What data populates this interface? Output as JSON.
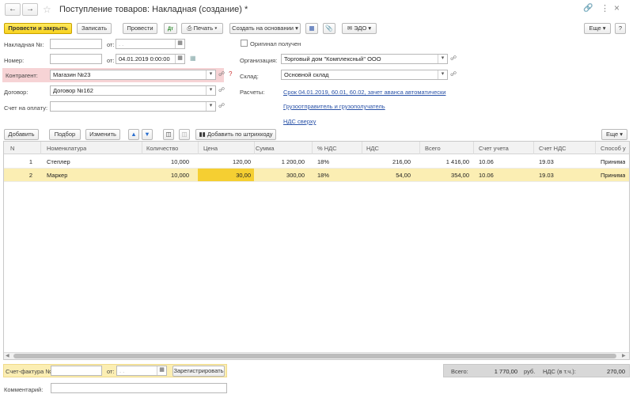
{
  "window": {
    "title": "Поступление товаров: Накладная (создание) *"
  },
  "toolbar": {
    "post_close": "Провести и закрыть",
    "save": "Записать",
    "post": "Провести",
    "print": "Печать",
    "create_based": "Создать на основании",
    "edo": "ЭДО",
    "more": "Еще"
  },
  "form": {
    "invoice_no_label": "Накладная №:",
    "invoice_from_label": "от:",
    "invoice_date_placeholder": ". .",
    "number_label": "Номер:",
    "number_from_label": "от:",
    "number_date": "04.01.2019  0:00:00",
    "contractor_label": "Контрагент:",
    "contractor_value": "Магазин №23",
    "contract_label": "Договор:",
    "contract_value": "Договор №162",
    "pay_account_label": "Счет на оплату:",
    "original_received_label": "Оригинал получен",
    "organization_label": "Организация:",
    "organization_value": "Торговый дом \"Комплексный\" ООО",
    "warehouse_label": "Склад:",
    "warehouse_value": "Основной склад",
    "settlements_label": "Расчеты:",
    "settlements_link": "Срок 04.01.2019, 60.01, 60.02, зачет аванса автоматически",
    "consignor_link": "Грузоотправитель и грузополучатель",
    "vat_link": "НДС сверху"
  },
  "table_toolbar": {
    "add": "Добавить",
    "pick": "Подбор",
    "edit": "Изменить",
    "barcode": "Добавить по штрихкоду",
    "more": "Еще"
  },
  "table": {
    "headers": [
      "N",
      "Номенклатура",
      "Количество",
      "Цена",
      "Сумма",
      "% НДС",
      "НДС",
      "Всего",
      "Счет учета",
      "Счет НДС",
      "Способ у"
    ],
    "rows": [
      [
        "1",
        "Степлер",
        "10,000",
        "120,00",
        "1 200,00",
        "18%",
        "216,00",
        "1 416,00",
        "10.06",
        "19.03",
        "Принима"
      ],
      [
        "2",
        "Маркер",
        "10,000",
        "30,00",
        "300,00",
        "18%",
        "54,00",
        "354,00",
        "10.06",
        "19.03",
        "Принима"
      ]
    ]
  },
  "footer": {
    "invoice_label": "Счет-фактура №:",
    "invoice_from": "от:",
    "invoice_date_placeholder": ". .",
    "register": "Зарегистрировать",
    "comment_label": "Комментарий:",
    "total_label": "Всего:",
    "total_value": "1 770,00",
    "currency": "руб.",
    "vat_label": "НДС (в т.ч.):",
    "vat_value": "270,00"
  },
  "colors": {
    "accent_yellow": "#f8d21f",
    "selected_row": "#fbeeb3",
    "highlight_cell": "#f5cf32",
    "link_blue": "#2b53a8",
    "required_pink": "#f6d3d5"
  }
}
